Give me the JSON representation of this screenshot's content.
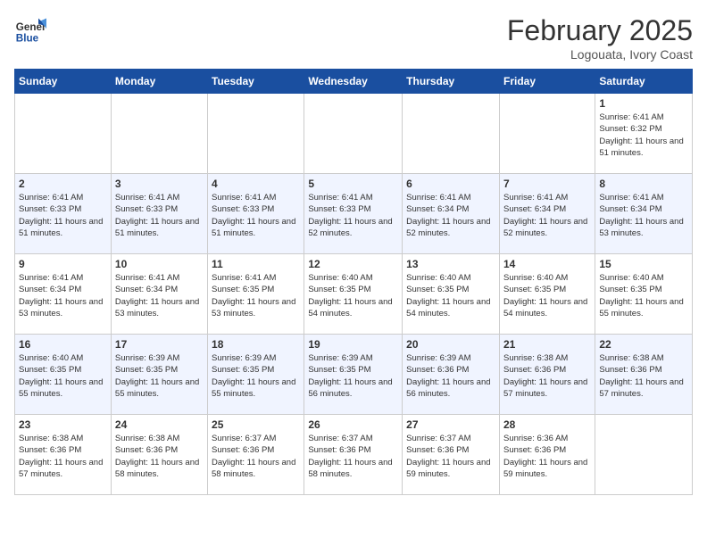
{
  "header": {
    "logo_general": "General",
    "logo_blue": "Blue",
    "month_title": "February 2025",
    "location": "Logouata, Ivory Coast"
  },
  "columns": [
    "Sunday",
    "Monday",
    "Tuesday",
    "Wednesday",
    "Thursday",
    "Friday",
    "Saturday"
  ],
  "weeks": [
    [
      {
        "day": "",
        "info": ""
      },
      {
        "day": "",
        "info": ""
      },
      {
        "day": "",
        "info": ""
      },
      {
        "day": "",
        "info": ""
      },
      {
        "day": "",
        "info": ""
      },
      {
        "day": "",
        "info": ""
      },
      {
        "day": "1",
        "info": "Sunrise: 6:41 AM\nSunset: 6:32 PM\nDaylight: 11 hours and 51 minutes."
      }
    ],
    [
      {
        "day": "2",
        "info": "Sunrise: 6:41 AM\nSunset: 6:33 PM\nDaylight: 11 hours and 51 minutes."
      },
      {
        "day": "3",
        "info": "Sunrise: 6:41 AM\nSunset: 6:33 PM\nDaylight: 11 hours and 51 minutes."
      },
      {
        "day": "4",
        "info": "Sunrise: 6:41 AM\nSunset: 6:33 PM\nDaylight: 11 hours and 51 minutes."
      },
      {
        "day": "5",
        "info": "Sunrise: 6:41 AM\nSunset: 6:33 PM\nDaylight: 11 hours and 52 minutes."
      },
      {
        "day": "6",
        "info": "Sunrise: 6:41 AM\nSunset: 6:34 PM\nDaylight: 11 hours and 52 minutes."
      },
      {
        "day": "7",
        "info": "Sunrise: 6:41 AM\nSunset: 6:34 PM\nDaylight: 11 hours and 52 minutes."
      },
      {
        "day": "8",
        "info": "Sunrise: 6:41 AM\nSunset: 6:34 PM\nDaylight: 11 hours and 53 minutes."
      }
    ],
    [
      {
        "day": "9",
        "info": "Sunrise: 6:41 AM\nSunset: 6:34 PM\nDaylight: 11 hours and 53 minutes."
      },
      {
        "day": "10",
        "info": "Sunrise: 6:41 AM\nSunset: 6:34 PM\nDaylight: 11 hours and 53 minutes."
      },
      {
        "day": "11",
        "info": "Sunrise: 6:41 AM\nSunset: 6:35 PM\nDaylight: 11 hours and 53 minutes."
      },
      {
        "day": "12",
        "info": "Sunrise: 6:40 AM\nSunset: 6:35 PM\nDaylight: 11 hours and 54 minutes."
      },
      {
        "day": "13",
        "info": "Sunrise: 6:40 AM\nSunset: 6:35 PM\nDaylight: 11 hours and 54 minutes."
      },
      {
        "day": "14",
        "info": "Sunrise: 6:40 AM\nSunset: 6:35 PM\nDaylight: 11 hours and 54 minutes."
      },
      {
        "day": "15",
        "info": "Sunrise: 6:40 AM\nSunset: 6:35 PM\nDaylight: 11 hours and 55 minutes."
      }
    ],
    [
      {
        "day": "16",
        "info": "Sunrise: 6:40 AM\nSunset: 6:35 PM\nDaylight: 11 hours and 55 minutes."
      },
      {
        "day": "17",
        "info": "Sunrise: 6:39 AM\nSunset: 6:35 PM\nDaylight: 11 hours and 55 minutes."
      },
      {
        "day": "18",
        "info": "Sunrise: 6:39 AM\nSunset: 6:35 PM\nDaylight: 11 hours and 55 minutes."
      },
      {
        "day": "19",
        "info": "Sunrise: 6:39 AM\nSunset: 6:35 PM\nDaylight: 11 hours and 56 minutes."
      },
      {
        "day": "20",
        "info": "Sunrise: 6:39 AM\nSunset: 6:36 PM\nDaylight: 11 hours and 56 minutes."
      },
      {
        "day": "21",
        "info": "Sunrise: 6:38 AM\nSunset: 6:36 PM\nDaylight: 11 hours and 57 minutes."
      },
      {
        "day": "22",
        "info": "Sunrise: 6:38 AM\nSunset: 6:36 PM\nDaylight: 11 hours and 57 minutes."
      }
    ],
    [
      {
        "day": "23",
        "info": "Sunrise: 6:38 AM\nSunset: 6:36 PM\nDaylight: 11 hours and 57 minutes."
      },
      {
        "day": "24",
        "info": "Sunrise: 6:38 AM\nSunset: 6:36 PM\nDaylight: 11 hours and 58 minutes."
      },
      {
        "day": "25",
        "info": "Sunrise: 6:37 AM\nSunset: 6:36 PM\nDaylight: 11 hours and 58 minutes."
      },
      {
        "day": "26",
        "info": "Sunrise: 6:37 AM\nSunset: 6:36 PM\nDaylight: 11 hours and 58 minutes."
      },
      {
        "day": "27",
        "info": "Sunrise: 6:37 AM\nSunset: 6:36 PM\nDaylight: 11 hours and 59 minutes."
      },
      {
        "day": "28",
        "info": "Sunrise: 6:36 AM\nSunset: 6:36 PM\nDaylight: 11 hours and 59 minutes."
      },
      {
        "day": "",
        "info": ""
      }
    ]
  ]
}
